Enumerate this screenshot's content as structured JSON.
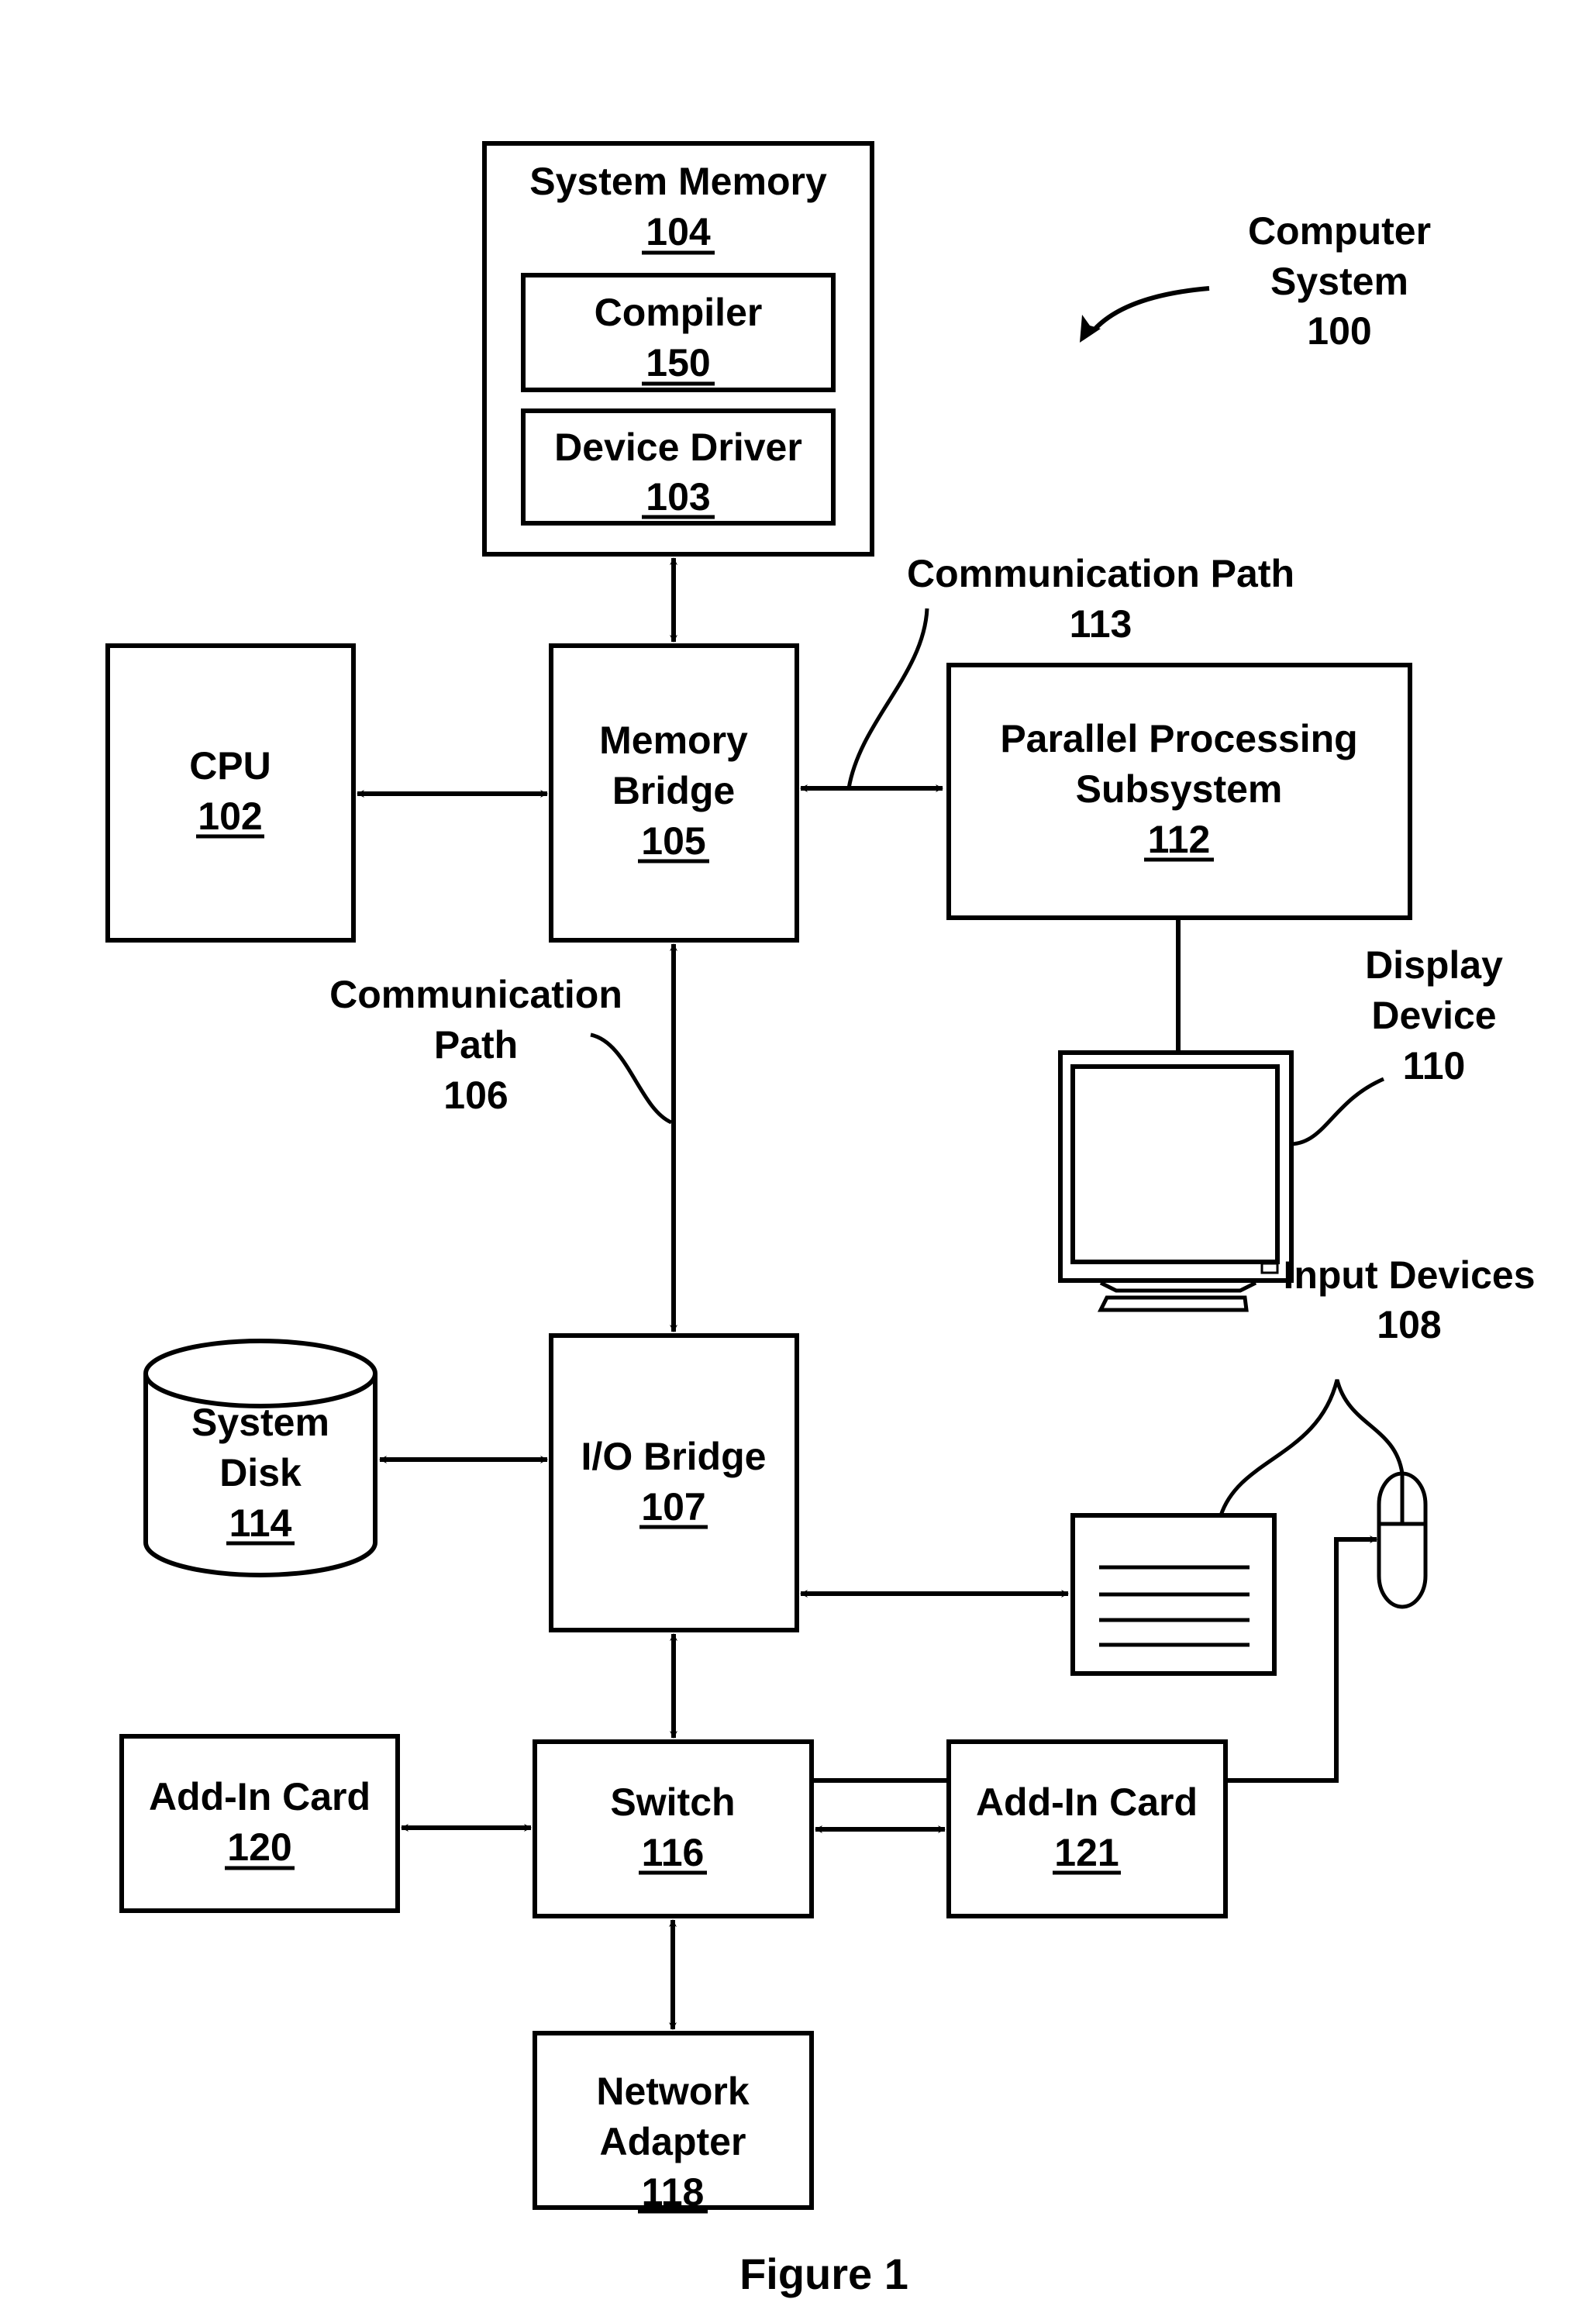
{
  "figure": {
    "caption": "Figure 1",
    "system_label": {
      "lines": [
        "Computer",
        "System",
        "100"
      ]
    }
  },
  "components": {
    "system_memory": {
      "name": "System Memory",
      "ref": "104"
    },
    "compiler": {
      "name": "Compiler",
      "ref": "150"
    },
    "device_driver": {
      "name": "Device Driver",
      "ref": "103"
    },
    "cpu": {
      "name": "CPU",
      "ref": "102"
    },
    "memory_bridge": {
      "lines": [
        "Memory",
        "Bridge"
      ],
      "ref": "105"
    },
    "parallel_processing_subsystem": {
      "lines": [
        "Parallel Processing",
        "Subsystem"
      ],
      "ref": "112"
    },
    "display_device": {
      "lines": [
        "Display",
        "Device",
        "110"
      ]
    },
    "system_disk": {
      "lines": [
        "System",
        "Disk"
      ],
      "ref": "114"
    },
    "io_bridge": {
      "name": "I/O Bridge",
      "ref": "107"
    },
    "input_devices": {
      "lines": [
        "Input Devices",
        "108"
      ]
    },
    "add_in_card_120": {
      "name": "Add-In Card",
      "ref": "120"
    },
    "switch": {
      "name": "Switch",
      "ref": "116"
    },
    "add_in_card_121": {
      "name": "Add-In Card",
      "ref": "121"
    },
    "network_adapter": {
      "lines": [
        "Network",
        "Adapter"
      ],
      "ref": "118"
    }
  },
  "paths": {
    "path_113": {
      "lines": [
        "Communication Path",
        "113"
      ]
    },
    "path_106": {
      "lines": [
        "Communication",
        "Path",
        "106"
      ]
    }
  },
  "connections": [
    {
      "from": "system_memory",
      "to": "memory_bridge",
      "type": "bidirectional"
    },
    {
      "from": "cpu",
      "to": "memory_bridge",
      "type": "bidirectional"
    },
    {
      "from": "memory_bridge",
      "to": "parallel_processing_subsystem",
      "type": "bidirectional",
      "label": "113"
    },
    {
      "from": "parallel_processing_subsystem",
      "to": "display_device",
      "type": "line"
    },
    {
      "from": "memory_bridge",
      "to": "io_bridge",
      "type": "bidirectional",
      "label": "106"
    },
    {
      "from": "system_disk",
      "to": "io_bridge",
      "type": "bidirectional"
    },
    {
      "from": "io_bridge",
      "to": "keyboard",
      "type": "bidirectional"
    },
    {
      "from": "mouse",
      "to": "io_bridge",
      "type": "unidirectional"
    },
    {
      "from": "io_bridge",
      "to": "switch",
      "type": "bidirectional"
    },
    {
      "from": "add_in_card_120",
      "to": "switch",
      "type": "bidirectional"
    },
    {
      "from": "switch",
      "to": "add_in_card_121",
      "type": "bidirectional"
    },
    {
      "from": "switch",
      "to": "network_adapter",
      "type": "bidirectional"
    }
  ]
}
